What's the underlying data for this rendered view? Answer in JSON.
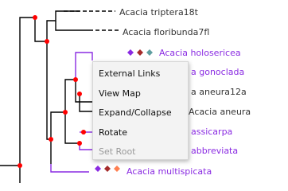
{
  "tree": {
    "leaves": [
      {
        "label": "Acacia triptera18t",
        "color": "#333333"
      },
      {
        "label": "Acacia floribunda7fl",
        "color": "#333333"
      },
      {
        "label": "Acacia holosericea",
        "color": "#8a2be2",
        "markers": [
          "#8a2be2",
          "#a52a2a",
          "#5f9ea0"
        ]
      },
      {
        "label": "a gonoclada",
        "color": "#8a2be2"
      },
      {
        "label": "a aneura12a",
        "color": "#333333"
      },
      {
        "label": "Acacia aneura",
        "color": "#333333"
      },
      {
        "label": "assicarpa",
        "color": "#8a2be2"
      },
      {
        "label": "abbreviata",
        "color": "#8a2be2"
      },
      {
        "label": "Acacia multispicata",
        "color": "#8a2be2",
        "markers": [
          "#8a2be2",
          "#a52a2a",
          "#ff7f50"
        ]
      }
    ],
    "branch_color_default": "#000000",
    "branch_color_highlight": "#8a2be2",
    "node_color": "#ff0000"
  },
  "context_menu": {
    "items": [
      {
        "label": "External Links",
        "enabled": true
      },
      {
        "label": "View Map",
        "enabled": true
      },
      {
        "label": "Expand/Collapse",
        "enabled": true
      },
      {
        "label": "Rotate",
        "enabled": true
      },
      {
        "label": "Set Root",
        "enabled": false
      }
    ]
  }
}
